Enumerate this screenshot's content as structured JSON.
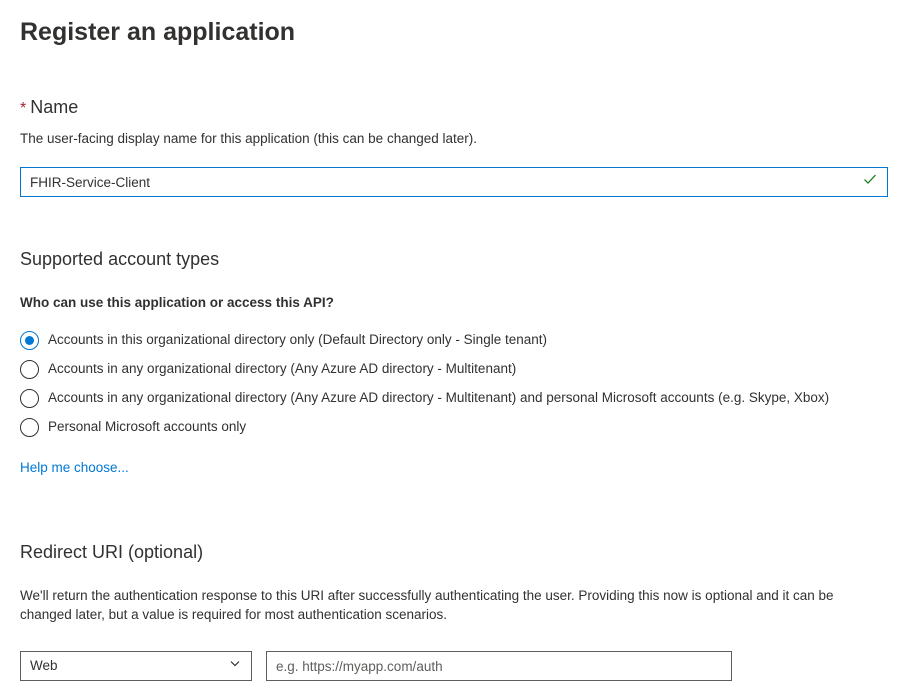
{
  "page_title": "Register an application",
  "name_field": {
    "label": "Name",
    "help": "The user-facing display name for this application (this can be changed later).",
    "value": "FHIR-Service-Client"
  },
  "account_types": {
    "title": "Supported account types",
    "question": "Who can use this application or access this API?",
    "options": [
      {
        "label": "Accounts in this organizational directory only (Default Directory only - Single tenant)",
        "selected": true
      },
      {
        "label": "Accounts in any organizational directory (Any Azure AD directory - Multitenant)",
        "selected": false
      },
      {
        "label": "Accounts in any organizational directory (Any Azure AD directory - Multitenant) and personal Microsoft accounts (e.g. Skype, Xbox)",
        "selected": false
      },
      {
        "label": "Personal Microsoft accounts only",
        "selected": false
      }
    ],
    "help_link": "Help me choose..."
  },
  "redirect_uri": {
    "title": "Redirect URI (optional)",
    "description": "We'll return the authentication response to this URI after successfully authenticating the user. Providing this now is optional and it can be changed later, but a value is required for most authentication scenarios.",
    "platform_selected": "Web",
    "uri_placeholder": "e.g. https://myapp.com/auth"
  }
}
